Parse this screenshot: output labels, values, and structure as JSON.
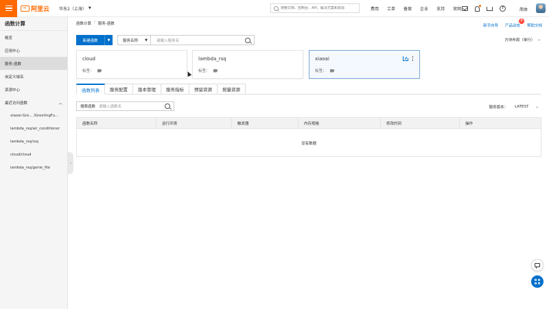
{
  "header": {
    "logo_text": "阿里云",
    "region": "华东2（上海）",
    "search_placeholder": "搜索文档、控制台、API、解决方案和资源",
    "nav": [
      "费用",
      "工单",
      "备案",
      "企业",
      "支持",
      "官网"
    ],
    "lang": "简体"
  },
  "sidebar": {
    "title": "函数计算",
    "items": [
      {
        "label": "概览"
      },
      {
        "label": "应用中心"
      },
      {
        "label": "服务-函数"
      },
      {
        "label": "自定义域名"
      },
      {
        "label": "资源中心"
      }
    ],
    "recent_title": "最近访问函数",
    "recent": [
      {
        "label": "xiaoai-Gre... /GreetingFu..."
      },
      {
        "label": "lambda_rsq/air_conditioner"
      },
      {
        "label": "lambda_rsq/rsq"
      },
      {
        "label": "cloud/cloud"
      },
      {
        "label": "lambda_rsq/genie_file"
      }
    ]
  },
  "main": {
    "breadcrumb": [
      "函数计算",
      "服务-函数"
    ],
    "help_links": {
      "guide": "新手向导",
      "news": "产品动态",
      "news_badge": "8",
      "docs": "帮助文档"
    },
    "new_function_label": "新建函数",
    "service_filter": {
      "select": "服务名称",
      "placeholder": "请输入服务名"
    },
    "layout_select": "方块布局（单行）",
    "cards": [
      {
        "name": "cloud",
        "tag_label": "标签："
      },
      {
        "name": "lambda_rsq",
        "tag_label": "标签："
      },
      {
        "name": "xiaoai",
        "tag_label": "标签："
      }
    ],
    "tabs": [
      "函数列表",
      "服务配置",
      "版本管理",
      "服务指标",
      "预留资源",
      "按量资源"
    ],
    "function_search": {
      "label": "搜索函数",
      "placeholder": "请输入函数名"
    },
    "version": {
      "label": "服务版本：",
      "value": "LATEST"
    },
    "table": {
      "columns": [
        "函数名称",
        "运行环境",
        "触发器",
        "内存规格",
        "修改时间",
        "操作"
      ],
      "empty_text": "没有数据"
    }
  },
  "colors": {
    "brand": "#ff6a00",
    "primary": "#0070cc"
  }
}
